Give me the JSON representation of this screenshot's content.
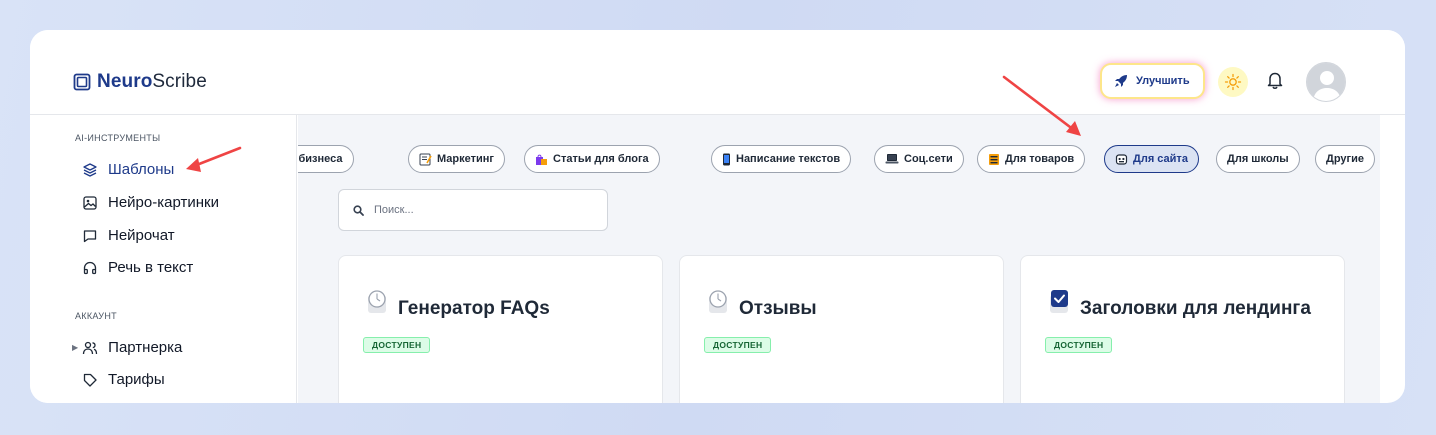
{
  "app": {
    "logo_bold": "Neuro",
    "logo_rest": "Scribe"
  },
  "header": {
    "upgrade_label": "Улучшить"
  },
  "sidebar": {
    "section_tools": "AI-ИНСТРУМЕНТЫ",
    "tools": [
      {
        "label": "Шаблоны",
        "icon": "layers-icon",
        "active": true
      },
      {
        "label": "Нейро-картинки",
        "icon": "image-icon"
      },
      {
        "label": "Нейрочат",
        "icon": "chat-icon"
      },
      {
        "label": "Речь в текст",
        "icon": "headphones-icon"
      }
    ],
    "section_account": "АККАУНТ",
    "account": [
      {
        "label": "Партнерка",
        "icon": "users-icon"
      },
      {
        "label": "Тарифы",
        "icon": "tag-icon"
      }
    ]
  },
  "categories": [
    {
      "label": "я бизнеса",
      "icon": ""
    },
    {
      "label": "Маркетинг",
      "icon": "memo-icon"
    },
    {
      "label": "Статьи для блога",
      "icon": "shopping-bags-icon"
    },
    {
      "label": "Написание текстов",
      "icon": "mobile-phone-icon"
    },
    {
      "label": "Соц.сети",
      "icon": "laptop-icon"
    },
    {
      "label": "Для товаров",
      "icon": "ledger-icon"
    },
    {
      "label": "Для сайта",
      "icon": "robot-icon",
      "active": true
    },
    {
      "label": "Для школы",
      "icon": ""
    },
    {
      "label": "Другие",
      "icon": ""
    }
  ],
  "search": {
    "placeholder": "Поиск..."
  },
  "cards": [
    {
      "title": "Генератор FAQs",
      "icon": "clock-icon",
      "badge": "ДОСТУПЕН"
    },
    {
      "title": "Отзывы",
      "icon": "clock-icon",
      "badge": "ДОСТУПЕН"
    },
    {
      "title": "Заголовки для лендинга",
      "icon": "check-box-icon",
      "badge": "ДОСТУПЕН"
    }
  ],
  "colors": {
    "accent": "#1e3a8a",
    "annotation_arrow": "#ef4444",
    "badge_bg": "#dcfce7"
  }
}
